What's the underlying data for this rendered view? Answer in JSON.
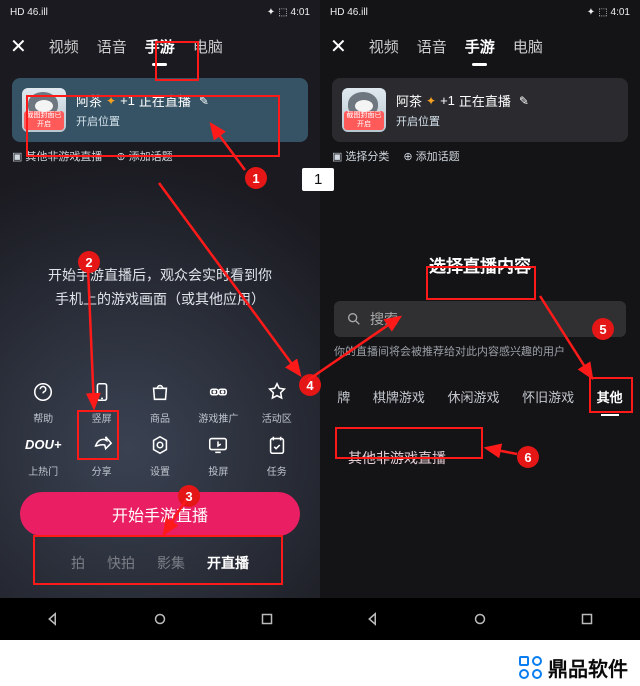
{
  "statusbar": {
    "hd": "HD",
    "net": "46.ill",
    "battery": "⬚",
    "time": "4:01"
  },
  "tabs": {
    "close": "✕",
    "video": "视频",
    "voice": "语音",
    "game": "手游",
    "pc": "电脑"
  },
  "live": {
    "namePrefix": "阿茶",
    "plusOne": "+1",
    "suffix": "正在直播",
    "sub": "开启位置",
    "badge": "截图封面已开启",
    "edit": "✎",
    "maple": "✦"
  },
  "metaLeft": {
    "cat": "其他非游戏直播",
    "topic": "添加话题"
  },
  "metaRight": {
    "cat": "选择分类",
    "topic": "添加话题"
  },
  "hint": {
    "l1": "开始手游直播后，观众会实时看到你",
    "l2": "手机上的游戏画面（或其他应用）"
  },
  "iconsTop": {
    "help": "帮助",
    "portrait": "竖屏",
    "goods": "商品",
    "promo": "游戏推广",
    "zone": "活动区"
  },
  "iconsBot": {
    "dou": "DOU+",
    "douSub": "上热门",
    "share": "分享",
    "settings": "设置",
    "cast": "投屏",
    "task": "任务"
  },
  "startBtn": "开始手游直播",
  "bottomTabs": {
    "a": "拍",
    "b": "快拍",
    "c": "影集",
    "d": "开直播"
  },
  "sheet": {
    "title": "选择直播内容",
    "searchPlaceholder": "搜索",
    "searchHint": "你的直播间将会被推荐给对此内容感兴趣的用户",
    "cats": {
      "a": "牌",
      "b": "棋牌游戏",
      "c": "休闲游戏",
      "d": "怀旧游戏",
      "e": "其他"
    },
    "row": "其他非游戏直播"
  },
  "midLabel": "1",
  "badges": {
    "b1": "1",
    "b2": "2",
    "b3": "3",
    "b4": "4",
    "b5": "5",
    "b6": "6"
  },
  "brand": "鼎品软件"
}
